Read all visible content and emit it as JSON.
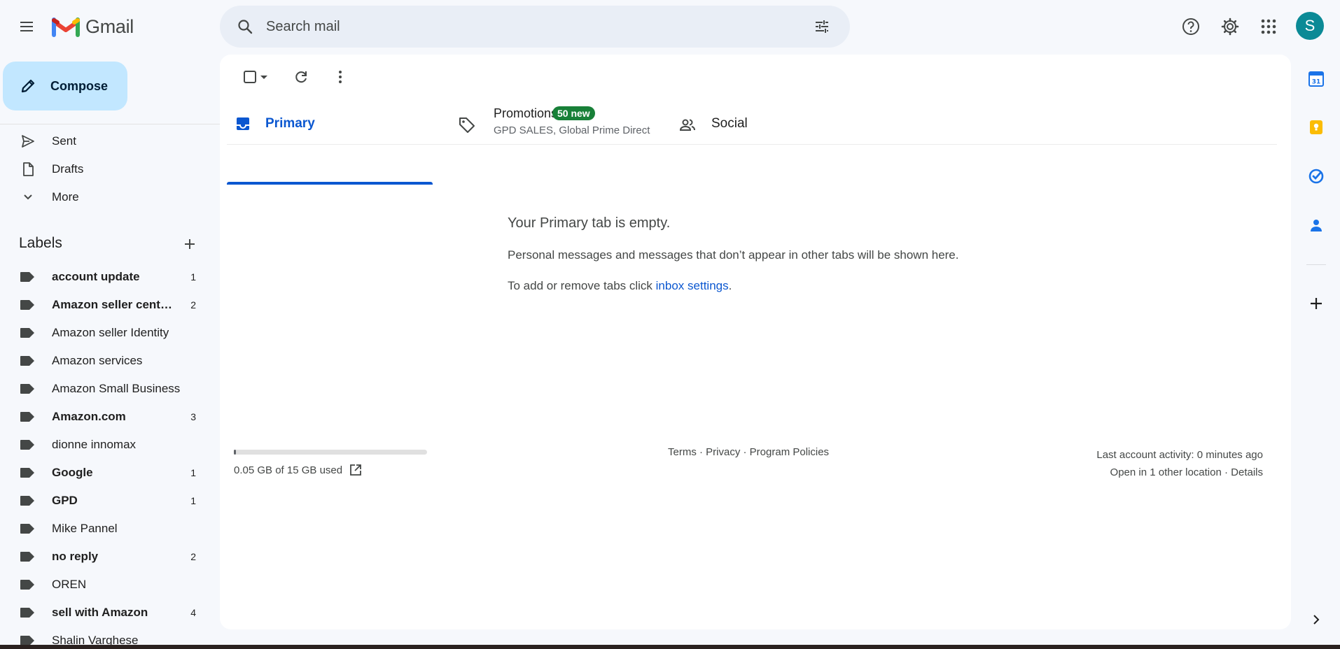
{
  "header": {
    "app_name": "Gmail",
    "search_placeholder": "Search mail",
    "avatar_initial": "S"
  },
  "nav": {
    "compose_label": "Compose",
    "items": [
      {
        "label": "Sent",
        "icon": "send-icon"
      },
      {
        "label": "Drafts",
        "icon": "draft-icon"
      },
      {
        "label": "More",
        "icon": "chevron-down-icon"
      }
    ]
  },
  "labels": {
    "heading": "Labels",
    "items": [
      {
        "name": "account update",
        "count": "1",
        "bold": true
      },
      {
        "name": "Amazon seller cent…",
        "count": "2",
        "bold": true
      },
      {
        "name": "Amazon seller Identity",
        "count": "",
        "bold": false
      },
      {
        "name": "Amazon services",
        "count": "",
        "bold": false
      },
      {
        "name": "Amazon Small Business",
        "count": "",
        "bold": false
      },
      {
        "name": "Amazon.com",
        "count": "3",
        "bold": true
      },
      {
        "name": "dionne innomax",
        "count": "",
        "bold": false
      },
      {
        "name": "Google",
        "count": "1",
        "bold": true
      },
      {
        "name": "GPD",
        "count": "1",
        "bold": true
      },
      {
        "name": "Mike Pannel",
        "count": "",
        "bold": false
      },
      {
        "name": "no reply",
        "count": "2",
        "bold": true
      },
      {
        "name": "OREN",
        "count": "",
        "bold": false
      },
      {
        "name": "sell with Amazon",
        "count": "4",
        "bold": true
      },
      {
        "name": "Shalin Varghese",
        "count": "",
        "bold": false
      }
    ]
  },
  "tabs": {
    "primary": "Primary",
    "promotions": "Promotions",
    "promotions_badge": "50 new",
    "promotions_senders": "GPD SALES, Global Prime Direct",
    "social": "Social"
  },
  "empty_state": {
    "title": "Your Primary tab is empty.",
    "description": "Personal messages and messages that don’t appear in other tabs will be shown here.",
    "tip_prefix": "To add or remove tabs click ",
    "tip_link": "inbox settings",
    "tip_suffix": "."
  },
  "footer": {
    "storage_text": "0.05 GB of 15 GB used",
    "storage_fraction": 0.0033,
    "links": "Terms · Privacy · Program Policies",
    "last_activity": "Last account activity: 0 minutes ago",
    "other_location": "Open in 1 other location · Details"
  },
  "side_panel": {
    "icons": [
      "calendar-icon",
      "keep-icon",
      "tasks-icon",
      "contacts-icon",
      "add-icon",
      "expand-chevron-icon"
    ],
    "calendar_day": "31"
  },
  "colors": {
    "accent": "#0b57d0",
    "compose_bg": "#c2e7ff",
    "badge": "#188038",
    "avatar": "#0b8a96"
  }
}
